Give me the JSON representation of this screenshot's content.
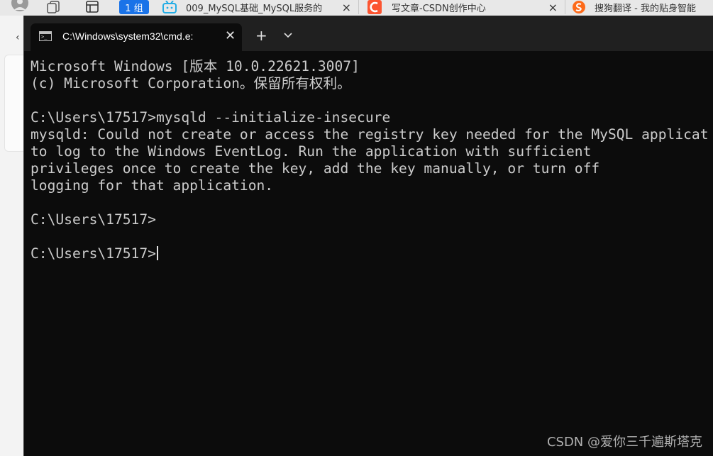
{
  "browser": {
    "group_label": "1 组",
    "tabs": [
      {
        "title": "009_MySQL基础_MySQL服务的",
        "close": "×"
      },
      {
        "title": "写文章-CSDN创作中心",
        "close": "×"
      },
      {
        "title": "搜狗翻译 - 我的贴身智能"
      }
    ]
  },
  "terminal": {
    "tab_title": "C:\\Windows\\system32\\cmd.e:",
    "tab_close": "✕",
    "new_tab": "+",
    "dropdown": "⌄",
    "lines": [
      "Microsoft Windows [版本 10.0.22621.3007]",
      "(c) Microsoft Corporation。保留所有权利。",
      "",
      "C:\\Users\\17517>mysqld --initialize-insecure",
      "mysqld: Could not create or access the registry key needed for the MySQL applicat",
      "to log to the Windows EventLog. Run the application with sufficient",
      "privileges once to create the key, add the key manually, or turn off",
      "logging for that application.",
      "",
      "C:\\Users\\17517>",
      "",
      "C:\\Users\\17517>"
    ]
  },
  "watermark": "CSDN @爱你三千遍斯塔克",
  "colors": {
    "terminal_bg": "#0c0c0c",
    "terminal_fg": "#cccccc",
    "tabbar_bg": "#202020",
    "group_badge": "#1a73e8"
  }
}
